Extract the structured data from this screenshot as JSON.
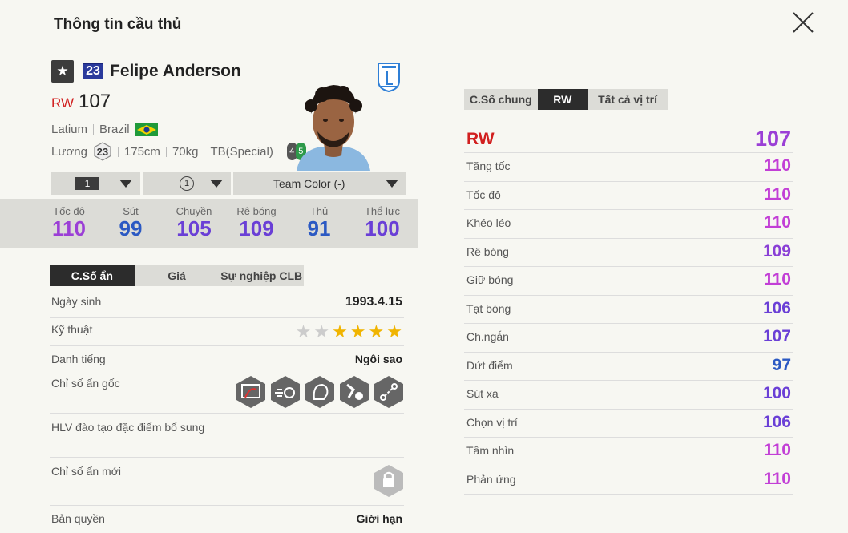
{
  "header": {
    "title": "Thông tin cầu thủ"
  },
  "player": {
    "badge_number": "23",
    "name": "Felipe Anderson",
    "position": "RW",
    "overall": "107",
    "club": "Latium",
    "nation": "Brazil",
    "salary_label": "Lương",
    "salary": "23",
    "height": "175cm",
    "weight": "70kg",
    "body_type": "TB(Special)",
    "weak_foot_left": "4",
    "weak_foot_right": "5"
  },
  "selectors": {
    "level": "1",
    "training": "1",
    "team_color": "Team Color (-)"
  },
  "summary_stats": [
    {
      "label": "Tốc độ",
      "value": "110",
      "color": "#9b3fd6"
    },
    {
      "label": "Sút",
      "value": "99",
      "color": "#2b59c3"
    },
    {
      "label": "Chuyền",
      "value": "105",
      "color": "#6a3fd6"
    },
    {
      "label": "Rê bóng",
      "value": "109",
      "color": "#6a3fd6"
    },
    {
      "label": "Thủ",
      "value": "91",
      "color": "#2b59c3"
    },
    {
      "label": "Thể lực",
      "value": "100",
      "color": "#6a3fd6"
    }
  ],
  "left_tabs": [
    "C.Số ẩn",
    "Giá",
    "Sự nghiệp CLB"
  ],
  "info": {
    "birth_label": "Ngày sinh",
    "birth": "1993.4.15",
    "skill_label": "Kỹ thuật",
    "skill_stars": 4,
    "skill_max": 6,
    "fame_label": "Danh tiếng",
    "fame": "Ngôi sao",
    "hidden_label": "Chỉ số ẩn gốc",
    "coach_label": "HLV đào tạo đặc điểm bổ sung",
    "new_hidden_label": "Chỉ số ẩn mới",
    "copyright_label": "Bản quyền",
    "copyright": "Giới hạn"
  },
  "right_tabs": [
    "C.Số chung",
    "RW",
    "Tất cả vị trí"
  ],
  "position_rating": {
    "label": "RW",
    "value": "107"
  },
  "attributes": [
    {
      "label": "Tăng tốc",
      "value": "110",
      "color": "#c23fd6"
    },
    {
      "label": "Tốc độ",
      "value": "110",
      "color": "#c23fd6"
    },
    {
      "label": "Khéo léo",
      "value": "110",
      "color": "#c23fd6"
    },
    {
      "label": "Rê bóng",
      "value": "109",
      "color": "#8a3fd6"
    },
    {
      "label": "Giữ bóng",
      "value": "110",
      "color": "#c23fd6"
    },
    {
      "label": "Tạt bóng",
      "value": "106",
      "color": "#6a3fd6"
    },
    {
      "label": "Ch.ngắn",
      "value": "107",
      "color": "#6a3fd6"
    },
    {
      "label": "Dứt điểm",
      "value": "97",
      "color": "#2b59c3"
    },
    {
      "label": "Sút xa",
      "value": "100",
      "color": "#6a3fd6"
    },
    {
      "label": "Chọn vị trí",
      "value": "106",
      "color": "#6a3fd6"
    },
    {
      "label": "Tầm nhìn",
      "value": "110",
      "color": "#c23fd6"
    },
    {
      "label": "Phản ứng",
      "value": "110",
      "color": "#c23fd6"
    }
  ]
}
